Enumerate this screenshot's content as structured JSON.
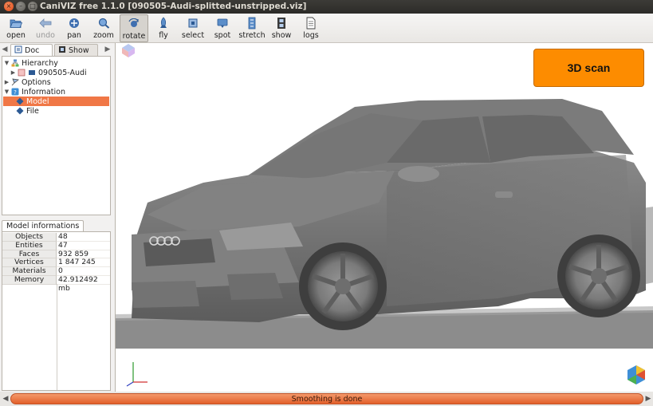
{
  "window": {
    "title": "CaniVIZ free 1.1.0 [090505-Audi-splitted-unstripped.viz]"
  },
  "toolbar": {
    "items": [
      {
        "label": "open",
        "icon": "open-folder-icon"
      },
      {
        "label": "undo",
        "icon": "undo-arrow-icon",
        "disabled": true
      },
      {
        "label": "pan",
        "icon": "pan-hand-icon"
      },
      {
        "label": "zoom",
        "icon": "zoom-icon"
      },
      {
        "label": "rotate",
        "icon": "rotate-icon",
        "active": true
      },
      {
        "label": "fly",
        "icon": "rocket-icon"
      },
      {
        "label": "select",
        "icon": "select-icon"
      },
      {
        "label": "spot",
        "icon": "spot-icon"
      },
      {
        "label": "stretch",
        "icon": "stretch-icon"
      },
      {
        "label": "show",
        "icon": "filmstrip-icon"
      },
      {
        "label": "logs",
        "icon": "logs-document-icon"
      }
    ]
  },
  "sidebar": {
    "tabs": [
      {
        "label": "Doc",
        "selected": true
      },
      {
        "label": "Show",
        "selected": false
      }
    ],
    "tree": [
      {
        "label": "Hierarchy",
        "expanded": true,
        "level": 0
      },
      {
        "label": "090505-Audi",
        "expanded": false,
        "level": 1
      },
      {
        "label": "Options",
        "expanded": false,
        "level": 0
      },
      {
        "label": "Information",
        "expanded": true,
        "level": 0
      },
      {
        "label": "Model",
        "level": 1,
        "selected": true
      },
      {
        "label": "File",
        "level": 1
      }
    ],
    "info_tab": "Model informations",
    "info_rows": [
      {
        "key": "Objects",
        "value": "48"
      },
      {
        "key": "Entities",
        "value": "47"
      },
      {
        "key": "Faces",
        "value": "932 859"
      },
      {
        "key": "Vertices",
        "value": "1 847 245"
      },
      {
        "key": "Materials",
        "value": "0"
      },
      {
        "key": "Memory",
        "value": "42.912492 mb"
      }
    ]
  },
  "viewport": {
    "overlay_button": "3D scan",
    "overlay_color": "#fd8c00"
  },
  "status": {
    "message": "Smoothing is done",
    "accent": "#e3602b"
  }
}
